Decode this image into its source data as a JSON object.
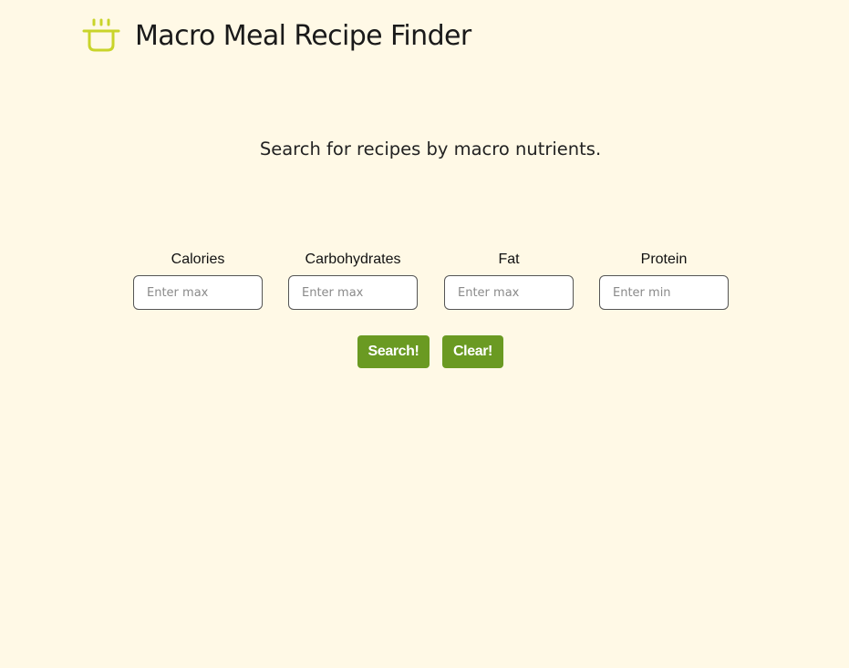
{
  "header": {
    "logo_icon": "pot-icon",
    "logo_color": "#c9d42a",
    "title": "Macro Meal Recipe Finder"
  },
  "tagline": "Search for recipes by macro nutrients.",
  "fields": [
    {
      "label": "Calories",
      "placeholder": "Enter max",
      "value": ""
    },
    {
      "label": "Carbohydrates",
      "placeholder": "Enter max",
      "value": ""
    },
    {
      "label": "Fat",
      "placeholder": "Enter max",
      "value": ""
    },
    {
      "label": "Protein",
      "placeholder": "Enter min",
      "value": ""
    }
  ],
  "buttons": {
    "search_label": "Search!",
    "clear_label": "Clear!",
    "button_color": "#6a9a22"
  },
  "colors": {
    "background": "#fff9e6"
  }
}
